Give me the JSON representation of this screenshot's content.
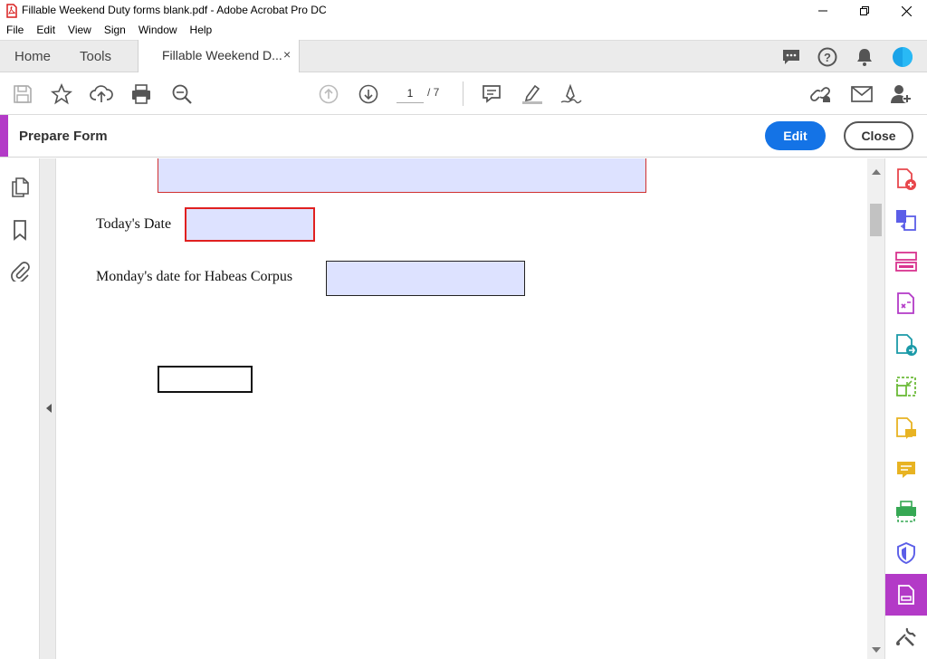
{
  "window": {
    "title": "Fillable Weekend Duty forms blank.pdf - Adobe Acrobat Pro DC"
  },
  "menu": [
    "File",
    "Edit",
    "View",
    "Sign",
    "Window",
    "Help"
  ],
  "tabs": {
    "home": "Home",
    "tools": "Tools",
    "document": "Fillable Weekend D...",
    "close_symbol": "×"
  },
  "toolbar": {
    "current_page": "1",
    "total_pages": "/ 7"
  },
  "form_bar": {
    "title": "Prepare Form",
    "edit_label": "Edit",
    "close_label": "Close"
  },
  "document": {
    "labels": {
      "todays_date": "Today's Date",
      "monday_date": "Monday's date for Habeas Corpus"
    }
  },
  "colors": {
    "accent_purple": "#b33ac7",
    "primary_blue": "#1473e6",
    "field_fill": "#dde2ff",
    "selected_border": "#e02020"
  },
  "icons": {
    "toolbar": [
      "save-icon",
      "bookmark-star-icon",
      "upload-icon",
      "print-icon",
      "zoom-icon",
      "page-up-icon",
      "page-down-icon",
      "comment-icon",
      "highlight-icon",
      "sign-icon",
      "share-link-icon",
      "email-icon",
      "add-user-icon"
    ],
    "left_nav": [
      "pages-icon",
      "bookmark-icon",
      "attachment-icon"
    ],
    "right_panel": [
      "create-pdf-icon",
      "combine-files-icon",
      "organize-pages-icon",
      "edit-pdf-icon",
      "export-pdf-icon",
      "compress-icon",
      "comment-file-icon",
      "comment-icon",
      "print-production-icon",
      "protect-icon",
      "prepare-form-icon",
      "more-tools-icon"
    ]
  }
}
